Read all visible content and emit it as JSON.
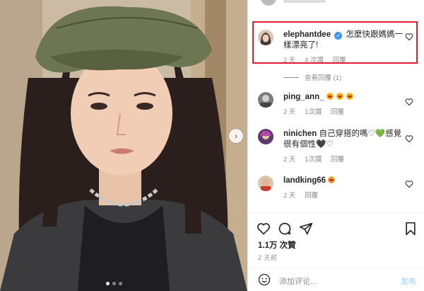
{
  "photo": {
    "alt_icon": "chevron-right-icon",
    "next_glyph": "›"
  },
  "comments": [
    {
      "username": "elephantdee",
      "verified": true,
      "verified_glyph": "✓",
      "text": "怎麼快跟媽媽一樣漂亮了!",
      "time": "2 天",
      "likes": "4 次讚",
      "reply": "回覆",
      "view_replies": "查看回覆 (1)"
    },
    {
      "username": "ping_ann_",
      "text": "",
      "emoji_count": 3,
      "time": "2 天",
      "likes": "1次讚",
      "reply": "回覆"
    },
    {
      "username": "ninichen",
      "text": "自己穿搭的嗎♡💚感覺很有個性🖤♡",
      "time": "2 天",
      "likes": "1次讚",
      "reply": "回覆"
    },
    {
      "username": "landking66",
      "text": "",
      "emoji_icon": "hands-emoji",
      "time": "2 天",
      "reply": "回覆"
    }
  ],
  "footer": {
    "likes": "1.1万 次贊",
    "time_ago": "2 天前",
    "comment_placeholder": "添加评论...",
    "post_label": "发布"
  },
  "colors": {
    "highlight": "#e0212f",
    "verified": "#3897f0",
    "muted": "#8e8e8e",
    "post": "#b2dffc"
  }
}
